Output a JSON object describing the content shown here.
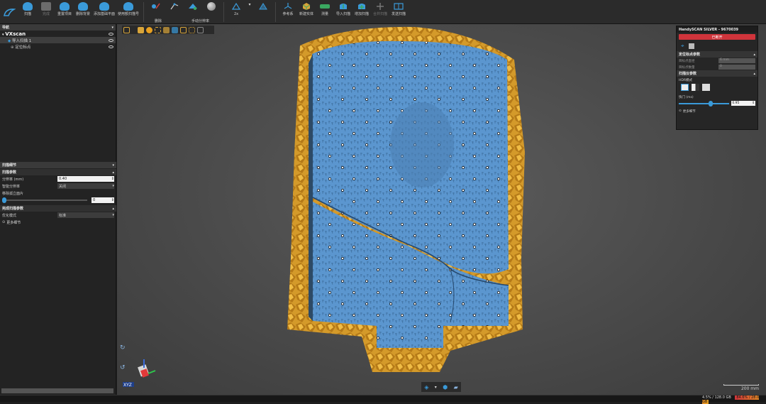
{
  "toolbar": {
    "buttons": [
      {
        "label": "扫描",
        "color": "#3a9ad9"
      },
      {
        "label": "完成",
        "color": "#8a8a8a",
        "disabled": true
      },
      {
        "label": "重置项目",
        "color": "#3a9ad9"
      },
      {
        "label": "删除背景",
        "color": "#3a9ad9"
      },
      {
        "label": "添加基础平面",
        "color": "#3a9ad9"
      },
      {
        "label": "使用额扫描号",
        "color": "#3a9ad9"
      }
    ],
    "edit_group_label": "删除",
    "resolution_label": "2x",
    "resolution_group_label": "手动分辨率",
    "right_buttons": [
      {
        "label": "参考系",
        "color": "#3a9ad9"
      },
      {
        "label": "新建实体",
        "color": "#d8a53a"
      },
      {
        "label": "测量",
        "color": "#3aa860"
      },
      {
        "label": "导入扫描",
        "color": "#3a9ad9"
      },
      {
        "label": "增加扫描",
        "color": "#3a9ad9"
      },
      {
        "label": "合并扫描",
        "color": "#8a8a8a",
        "disabled": true
      },
      {
        "label": "发送扫描",
        "color": "#3a9ad9"
      }
    ]
  },
  "nav": {
    "header": "导航",
    "root": "VXscan",
    "items": [
      {
        "label": "导入扫描 1"
      },
      {
        "label": "定位标点"
      }
    ]
  },
  "scan_settings": {
    "header": "扫描细节",
    "params_header": "扫描参数",
    "resolution_label": "分辨率 (mm)",
    "resolution_value": "0.40",
    "smart_label": "智能分辨率",
    "smart_value": "关闭",
    "remove_label": "移除孤立面片",
    "remove_value": "0",
    "finish_header": "完成扫描参数",
    "optimize_label": "优化模式",
    "optimize_value": "标准",
    "more": "更多细节"
  },
  "device": {
    "title": "HandySCAN SILVER - 9670039",
    "disconnect": "已断开",
    "position_header": "定位标点参数",
    "position_rows": [
      {
        "label": "目标点直径",
        "value": "6 mm"
      },
      {
        "label": "目标点数量",
        "value": "0"
      }
    ],
    "scanner_header": "扫描仪参数",
    "hdr_label": "HDR模式",
    "shutter_label": "快门 (ms)",
    "shutter_value": "0.95",
    "shutter_level": 0.62,
    "more": "更多细节"
  },
  "scale_label": "200 mm",
  "status": {
    "memory": "4.5% / 128.0 GB",
    "cpu": "84.6% / 28.0 GB"
  },
  "axis_label": "XYZ"
}
